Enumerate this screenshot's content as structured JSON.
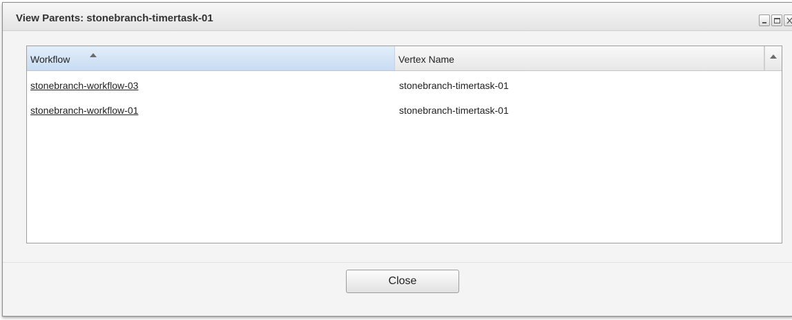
{
  "dialog": {
    "title": "View Parents: stonebranch-timertask-01",
    "window_controls": [
      "minimize-icon",
      "maximize-icon",
      "close-icon"
    ]
  },
  "grid": {
    "columns": [
      {
        "label": "Workflow",
        "sorted": "ascending"
      },
      {
        "label": "Vertex Name"
      }
    ],
    "rows": [
      {
        "workflow": "stonebranch-workflow-03",
        "vertex_name": "stonebranch-timertask-01"
      },
      {
        "workflow": "stonebranch-workflow-01",
        "vertex_name": "stonebranch-timertask-01"
      }
    ]
  },
  "footer": {
    "close_label": "Close"
  },
  "colors": {
    "sorted_header": "#c7dcf3",
    "link_text": "#222222",
    "dialog_bg": "#f4f4f4"
  }
}
